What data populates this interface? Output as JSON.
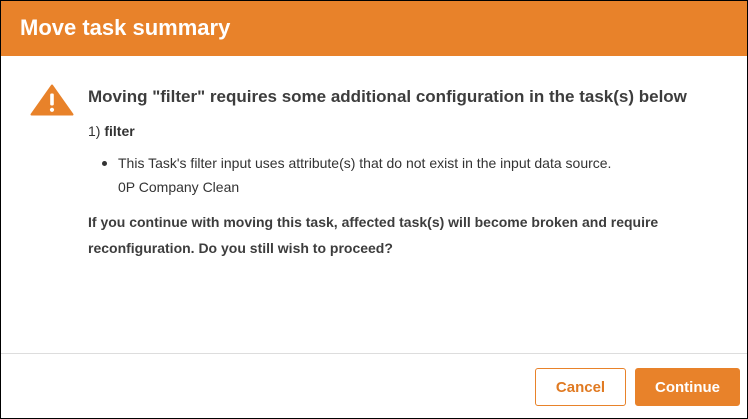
{
  "dialog": {
    "title": "Move task summary",
    "message_title": "Moving \"filter\" requires some additional configuration in the task(s) below",
    "task": {
      "number": "1)",
      "name": "filter"
    },
    "issues": [
      {
        "text": "This Task's filter input uses attribute(s) that do not exist in the input data source.",
        "source": "0P Company Clean"
      }
    ],
    "warning": "If you continue with moving this task, affected task(s) will become broken and require reconfiguration. Do you still wish to proceed?",
    "buttons": {
      "cancel_label": "Cancel",
      "continue_label": "Continue"
    },
    "icon": "warning-triangle-icon"
  },
  "colors": {
    "accent": "#e8822a",
    "header_text": "#ffffff",
    "body_text": "#333333"
  }
}
